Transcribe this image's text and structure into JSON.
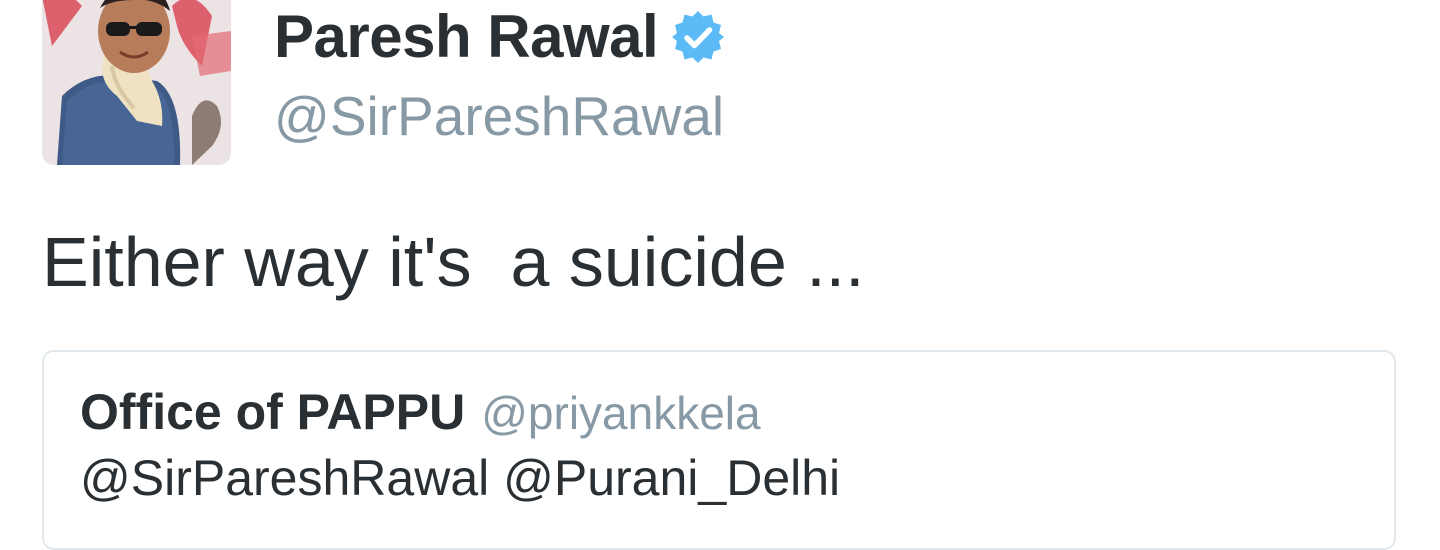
{
  "tweet": {
    "author": {
      "name": "Paresh Rawal",
      "handle": "@SirPareshRawal",
      "verified": true,
      "verified_color": "#1da1f2"
    },
    "text": "Either way it's  a suicide ...",
    "quoted_tweet": {
      "author_name": "Office of PAPPU",
      "author_handle": "@priyankkela",
      "text": "@SirPareshRawal @Purani_Delhi"
    }
  },
  "colors": {
    "text_primary": "#292f33",
    "text_secondary": "#8899a6",
    "card_border": "#e1e8ed",
    "background": "#ffffff"
  }
}
